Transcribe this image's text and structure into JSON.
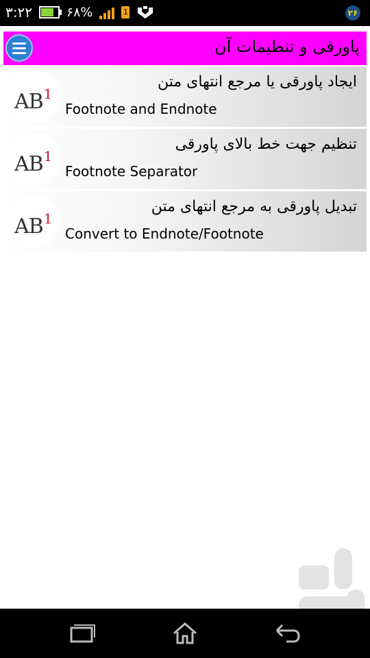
{
  "status_bar": {
    "time": "۳:۲۲",
    "battery_percent": "۶۸%",
    "battery_level": 0.68,
    "sim_label": "1",
    "notification_badge": "۲۶"
  },
  "app_bar": {
    "title": "پاورقی و تنظیمات آن",
    "menu_icon": "hamburger-menu-icon",
    "background_color": "#ff00ff"
  },
  "items": [
    {
      "title_fa": "ایجاد پاورقی یا مرجع انتهای متن",
      "title_en": "Footnote and Endnote",
      "icon_text": "AB",
      "icon_sup": "1"
    },
    {
      "title_fa": "تنظیم جهت خط بالای پاورقی",
      "title_en": "Footnote Separator",
      "icon_text": "AB",
      "icon_sup": "1"
    },
    {
      "title_fa": "تبدیل پاورقی به مرجع انتهای متن",
      "title_en": "Convert to Endnote/Footnote",
      "icon_text": "AB",
      "icon_sup": "1"
    }
  ],
  "nav_bar": {
    "recent_icon": "recent-apps-icon",
    "home_icon": "home-icon",
    "back_icon": "back-icon"
  }
}
